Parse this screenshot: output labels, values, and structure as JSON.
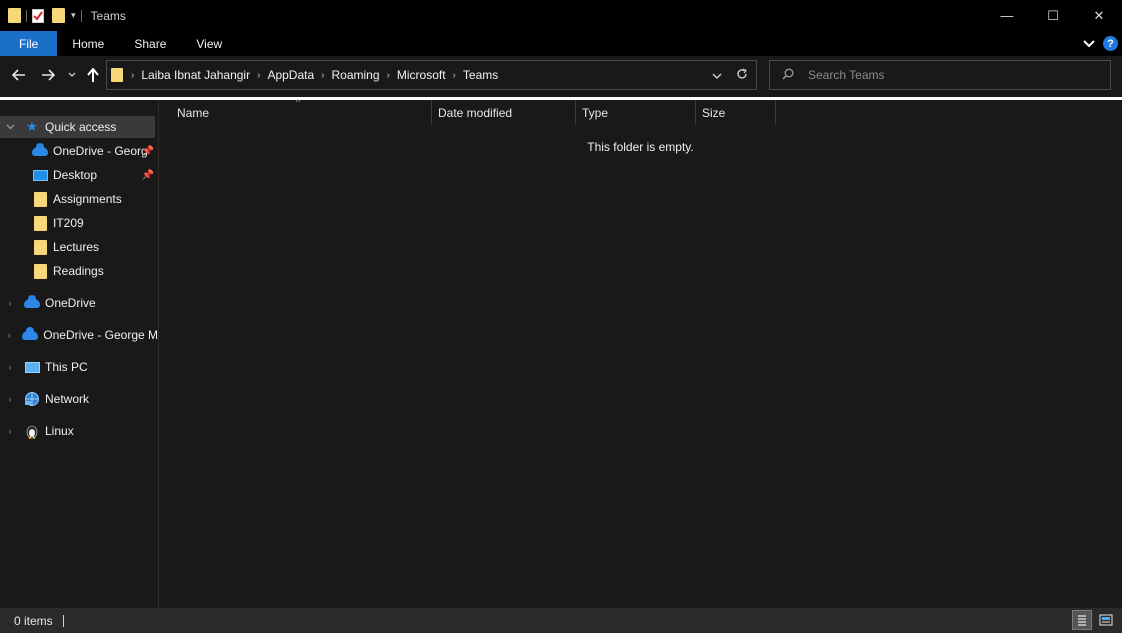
{
  "window": {
    "title": "Teams",
    "minimize_glyph": "—",
    "maximize_glyph": "☐",
    "close_glyph": "✕"
  },
  "ribbon": {
    "tabs": [
      "File",
      "Home",
      "Share",
      "View"
    ]
  },
  "address_bar": {
    "breadcrumbs": [
      "Laiba Ibnat Jahangir",
      "AppData",
      "Roaming",
      "Microsoft",
      "Teams"
    ]
  },
  "search": {
    "placeholder": "Search Teams"
  },
  "nav_pane": {
    "quick_access": "Quick access",
    "pinned": [
      {
        "label": "OneDrive - Georg",
        "icon": "onedrive-cloud-icon",
        "pinned": true
      },
      {
        "label": "Desktop",
        "icon": "desktop-icon",
        "pinned": true
      },
      {
        "label": "Assignments",
        "icon": "folder-icon",
        "pinned": false
      },
      {
        "label": "IT209",
        "icon": "folder-icon",
        "pinned": false
      },
      {
        "label": "Lectures",
        "icon": "folder-icon",
        "pinned": false
      },
      {
        "label": "Readings",
        "icon": "folder-icon",
        "pinned": false
      }
    ],
    "roots": [
      {
        "label": "OneDrive",
        "icon": "onedrive-cloud-icon"
      },
      {
        "label": "OneDrive - George M",
        "icon": "onedrive-cloud-icon"
      },
      {
        "label": "This PC",
        "icon": "computer-icon"
      },
      {
        "label": "Network",
        "icon": "network-icon"
      },
      {
        "label": "Linux",
        "icon": "linux-penguin-icon"
      }
    ]
  },
  "columns": {
    "name": "Name",
    "date_modified": "Date modified",
    "type": "Type",
    "size": "Size"
  },
  "content": {
    "empty_message": "This folder is empty."
  },
  "status": {
    "items": "0 items"
  },
  "colors": {
    "accent": "#1a6fc9",
    "folder": "#f6d878",
    "onedrive": "#2b87e8"
  }
}
